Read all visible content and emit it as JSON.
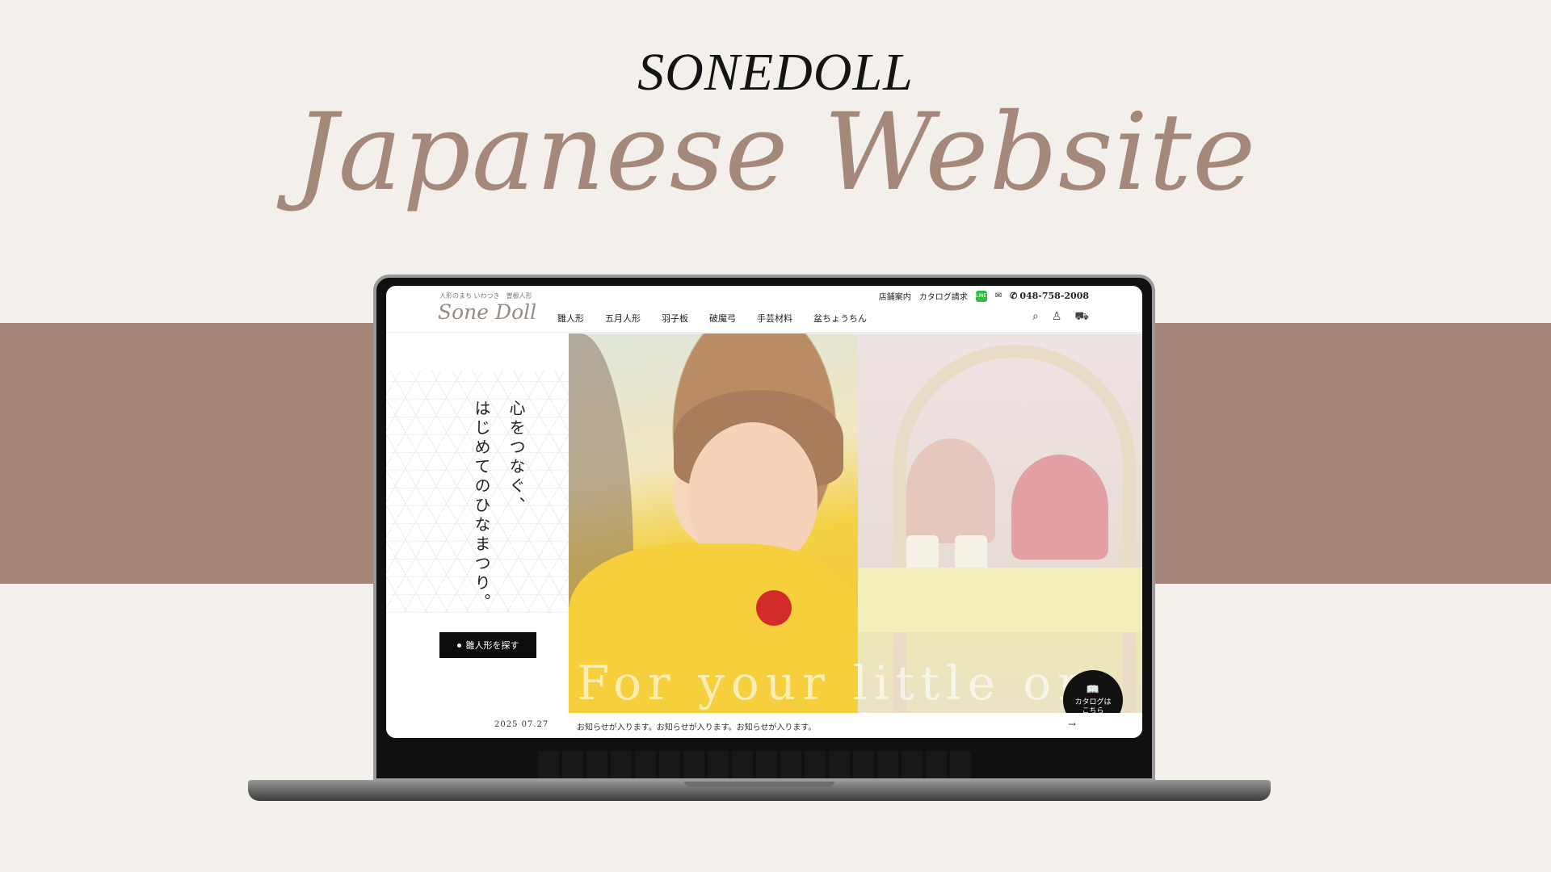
{
  "banner": {
    "brand": "SONEDOLL",
    "headline": "Japanese Website"
  },
  "site": {
    "logo_sub": "人形のまち いわつき　曽根人形",
    "logo": "Sone Doll",
    "top_links": {
      "store": "店舗案内",
      "catalog_request": "カタログ請求",
      "line_icon": "LINE",
      "mail_icon": "✉",
      "phone_icon": "✆",
      "phone": "048-758-2008"
    },
    "nav": [
      "雛人形",
      "五月人形",
      "羽子板",
      "破魔弓",
      "手芸材料",
      "盆ちょうちん"
    ],
    "header_icons": {
      "search": "⌕",
      "account": "♙",
      "cart": "⛟"
    }
  },
  "hero": {
    "copy_col1": "心をつなぐ、",
    "copy_col2": "はじめてのひなまつり。",
    "cta": "雛人形を探す",
    "overlay": "For your little on",
    "catalog_fab_icon": "📖",
    "catalog_fab_line1": "カタログは",
    "catalog_fab_line2": "こちら"
  },
  "news": {
    "date": "2025 07.27",
    "text": "お知らせが入ります。お知らせが入ります。お知らせが入ります。",
    "arrow": "→"
  },
  "colors": {
    "background": "#f3f0ec",
    "band": "#a48577",
    "headline": "#a4887a",
    "accent_dark": "#0d0d0d",
    "line_green": "#2fbf40"
  }
}
